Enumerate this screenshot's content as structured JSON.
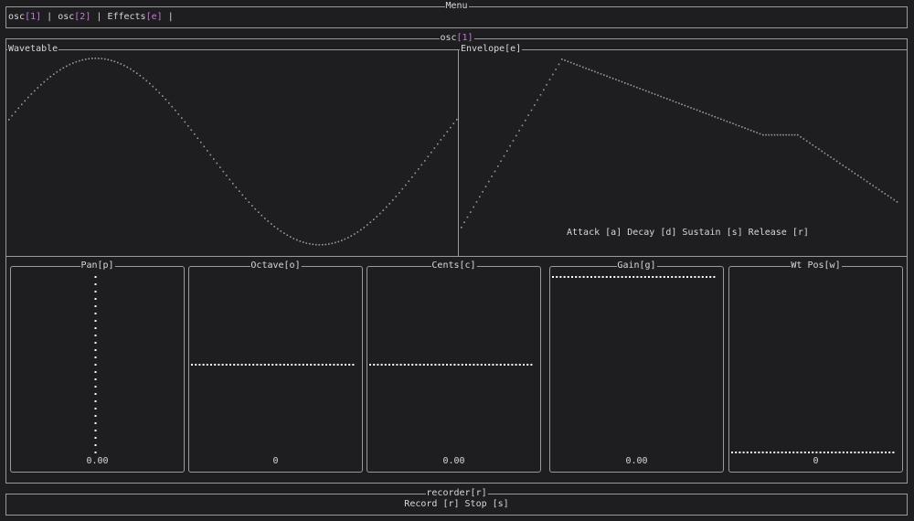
{
  "menu": {
    "title": "Menu",
    "items": [
      {
        "name": "osc",
        "key": "[1]"
      },
      {
        "name": "osc",
        "key": "[2]"
      },
      {
        "name": "Effects",
        "key": "[e]"
      }
    ],
    "separator": "|"
  },
  "osc_panel": {
    "title": "osc",
    "title_key": "[1]",
    "wavetable": {
      "title": "Wavetable"
    },
    "envelope": {
      "title": "Envelope[e]",
      "labels": "Attack [a] Decay [d] Sustain [s] Release [r]",
      "levels": {
        "attack_peak": 1.0,
        "sustain": 0.55,
        "release_end": 0.14
      }
    },
    "knobs": [
      {
        "title": "Pan[p]",
        "value": "0.00",
        "level": 0.0,
        "orientation": "vertical"
      },
      {
        "title": "Octave[o]",
        "value": "0",
        "level": 0.5,
        "orientation": "horizontal"
      },
      {
        "title": "Cents[c]",
        "value": "0.00",
        "level": 0.5,
        "orientation": "horizontal"
      },
      {
        "title": "Gain[g]",
        "value": "0.00",
        "level": 1.0,
        "orientation": "horizontal"
      },
      {
        "title": "Wt Pos[w]",
        "value": "0",
        "level": 0.0,
        "orientation": "horizontal"
      }
    ]
  },
  "recorder": {
    "title": "recorder[r]",
    "controls": "Record [r] Stop [s]"
  },
  "colors": {
    "background": "#1e1e20",
    "border": "#9a9a9a",
    "key_accent": "#c678dd",
    "text": "#d8d8d8"
  }
}
